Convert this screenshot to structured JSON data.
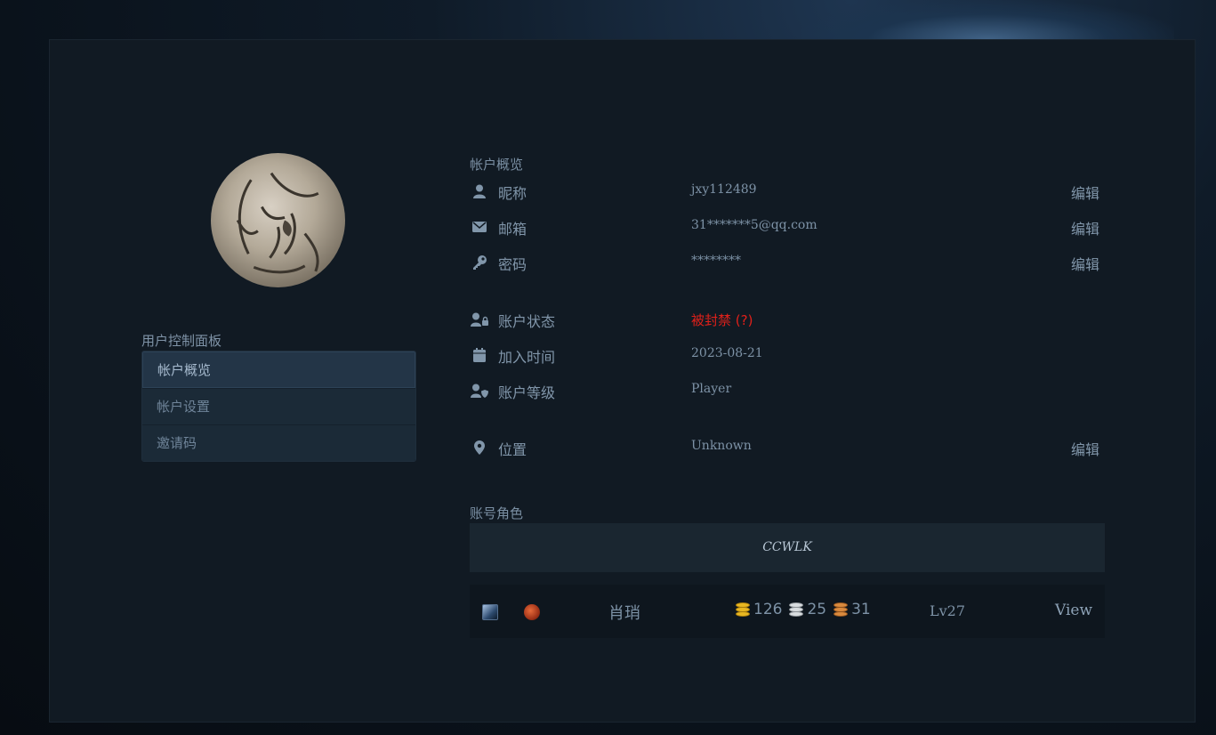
{
  "sidebar": {
    "title": "用户控制面板",
    "items": [
      {
        "label": "帐户概览",
        "active": true
      },
      {
        "label": "帐户设置",
        "active": false
      },
      {
        "label": "邀请码",
        "active": false
      }
    ]
  },
  "overview": {
    "title": "帐户概览",
    "rows": [
      {
        "icon": "user-icon",
        "label": "昵称",
        "value": "jxy112489",
        "edit": "编辑"
      },
      {
        "icon": "envelope-icon",
        "label": "邮箱",
        "value": "31*******5@qq.com",
        "edit": "编辑"
      },
      {
        "icon": "key-icon",
        "label": "密码",
        "value": "********",
        "edit": "编辑"
      },
      {
        "icon": "user-lock-icon",
        "label": "账户状态",
        "value": "被封禁 (?)"
      },
      {
        "icon": "calendar-icon",
        "label": "加入时间",
        "value": "2023-08-21"
      },
      {
        "icon": "user-shield-icon",
        "label": "账户等级",
        "value": "Player"
      },
      {
        "icon": "map-marker-icon",
        "label": "位置",
        "value": "Unknown",
        "edit": "编辑"
      }
    ]
  },
  "characters": {
    "title": "账号角色",
    "realm": "CCWLK",
    "list": [
      {
        "race_icon": "race-icon",
        "class_icon": "class-icon",
        "name": "肖琑",
        "gold": "126",
        "silver": "25",
        "copper": "31",
        "level": "Lv27",
        "action": "View"
      }
    ]
  },
  "colors": {
    "panel_bg": "#111a23",
    "banned": "#e0201a",
    "text": "#8196aa",
    "menu_active": "#233547"
  }
}
